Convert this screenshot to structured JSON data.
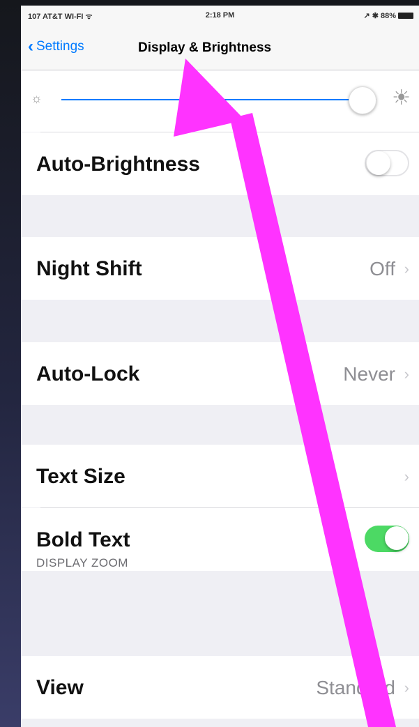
{
  "status_bar": {
    "carrier": "107 AT&T WI-FI ᯤ",
    "time": "2:18 PM",
    "right": "↗ ✱ 88%"
  },
  "nav": {
    "back_label": "Settings",
    "title": "Display & Brightness"
  },
  "brightness": {
    "level_fraction": 0.94
  },
  "cells": {
    "auto_brightness": {
      "label": "Auto-Brightness",
      "on": false
    },
    "night_shift": {
      "label": "Night Shift",
      "value": "Off"
    },
    "auto_lock": {
      "label": "Auto-Lock",
      "value": "Never"
    },
    "text_size": {
      "label": "Text Size"
    },
    "bold_text": {
      "label": "Bold Text",
      "on": true
    },
    "display_zoom_header": "DISPLAY ZOOM",
    "view": {
      "label": "View",
      "value": "Standard"
    }
  },
  "colors": {
    "accent": "#007aff",
    "toggle_on": "#4cd964",
    "annotation_arrow": "#ff33ff"
  },
  "icons": [
    "chevron-left-icon",
    "brightness-low-icon",
    "brightness-high-icon",
    "chevron-right-icon",
    "battery-icon"
  ]
}
